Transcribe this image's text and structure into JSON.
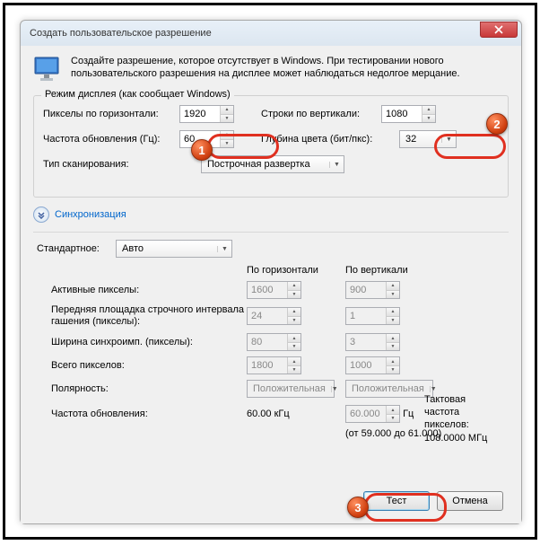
{
  "window": {
    "title": "Создать пользовательское разрешение"
  },
  "intro": "Создайте разрешение, которое отсутствует в Windows. При тестировании нового пользовательского разрешения на дисплее может наблюдаться недолгое мерцание.",
  "mode": {
    "legend": "Режим дисплея (как сообщает Windows)",
    "hpx_label": "Пикселы по горизонтали:",
    "hpx": "1920",
    "vpx_label": "Строки по вертикали:",
    "vpx": "1080",
    "refresh_label": "Частота обновления (Гц):",
    "refresh": "60",
    "depth_label": "Глубина цвета (бит/пкс):",
    "depth": "32",
    "scan_label": "Тип сканирования:",
    "scan": "Построчная развертка"
  },
  "sync": {
    "header": "Синхронизация",
    "std_label": "Стандартное:",
    "std": "Авто",
    "col_h": "По горизонтали",
    "col_v": "По вертикали",
    "active_label": "Активные пикселы:",
    "active_h": "1600",
    "active_v": "900",
    "porch_label": "Передняя площадка строчного интервала гашения (пикселы):",
    "porch_h": "24",
    "porch_v": "1",
    "syncw_label": "Ширина синхроимп. (пикселы):",
    "syncw_h": "80",
    "syncw_v": "3",
    "total_label": "Всего пикселов:",
    "total_h": "1800",
    "total_v": "1000",
    "pol_label": "Полярность:",
    "pol_h": "Положительная",
    "pol_v": "Положительная",
    "ref_label": "Частота обновления:",
    "ref_h": "60.00 кГц",
    "ref_v": "60.000",
    "ref_unit": "Гц",
    "range": "(от 59.000 до 61.000)",
    "clock_label": "Тактовая частота пикселов:",
    "clock": "108.0000 МГц"
  },
  "buttons": {
    "test": "Тест",
    "cancel": "Отмена"
  },
  "badges": {
    "b1": "1",
    "b2": "2",
    "b3": "3"
  }
}
